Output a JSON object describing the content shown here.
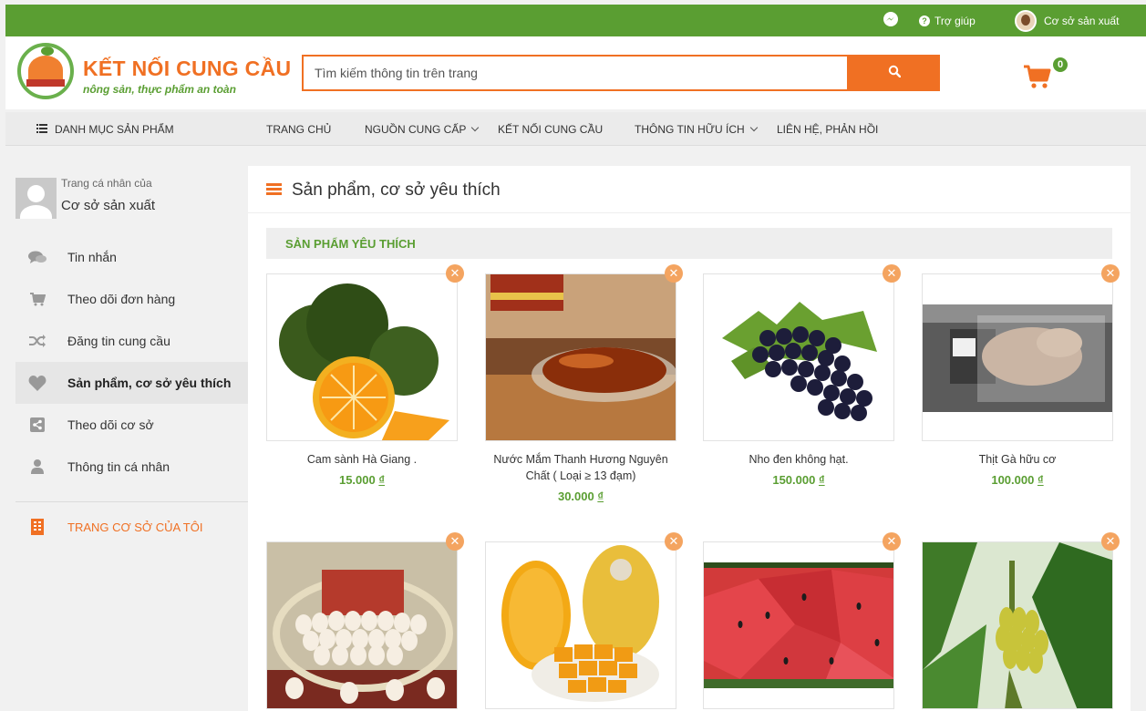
{
  "topbar": {
    "messenger_icon": "messenger-icon",
    "help": "Trợ giúp",
    "user": "Cơ sở sản xuất"
  },
  "header": {
    "logo_title": "KẾT NỐI CUNG CẦU",
    "logo_subtitle": "nông sản, thực phẩm an toàn",
    "search_placeholder": "Tìm kiếm thông tin trên trang",
    "cart_count": "0"
  },
  "nav": {
    "category": "DANH MỤC SẢN PHẨM",
    "items": [
      {
        "label": "TRANG CHỦ"
      },
      {
        "label": "NGUỒN CUNG CẤP"
      },
      {
        "label": "KẾT NỐI CUNG CẦU"
      },
      {
        "label": "THÔNG TIN HỮU ÍCH"
      },
      {
        "label": "LIÊN HỆ, PHẢN HỒI"
      }
    ]
  },
  "sidebar": {
    "profile_caption": "Trang cá nhân của",
    "profile_name": "Cơ sở sản xuất",
    "items": [
      {
        "label": "Tin nhắn",
        "icon": "chat-icon"
      },
      {
        "label": "Theo dõi đơn hàng",
        "icon": "cart-icon"
      },
      {
        "label": "Đăng tin cung cầu",
        "icon": "shuffle-icon"
      },
      {
        "label": "Sản phẩm, cơ sở yêu thích",
        "icon": "heart-icon",
        "active": true
      },
      {
        "label": "Theo dõi cơ sở",
        "icon": "share-icon"
      },
      {
        "label": "Thông tin cá nhân",
        "icon": "user-icon"
      }
    ],
    "shop_link": "TRANG CƠ SỞ CỦA TÔI"
  },
  "main": {
    "title": "Sản phẩm, cơ sở yêu thích",
    "section": "SẢN PHẨM YÊU THÍCH",
    "products": [
      {
        "name": "Cam sành Hà Giang .",
        "price": "15.000",
        "currency": "₫"
      },
      {
        "name": "Nước Mắm Thanh Hương Nguyên Chất ( Loại ≥ 13 đạm)",
        "price": "30.000",
        "currency": "₫"
      },
      {
        "name": "Nho đen không hạt.",
        "price": "150.000",
        "currency": "₫"
      },
      {
        "name": "Thịt Gà hữu cơ",
        "price": "100.000",
        "currency": "₫"
      }
    ]
  },
  "colors": {
    "green": "#5a9e32",
    "orange": "#f07023"
  }
}
